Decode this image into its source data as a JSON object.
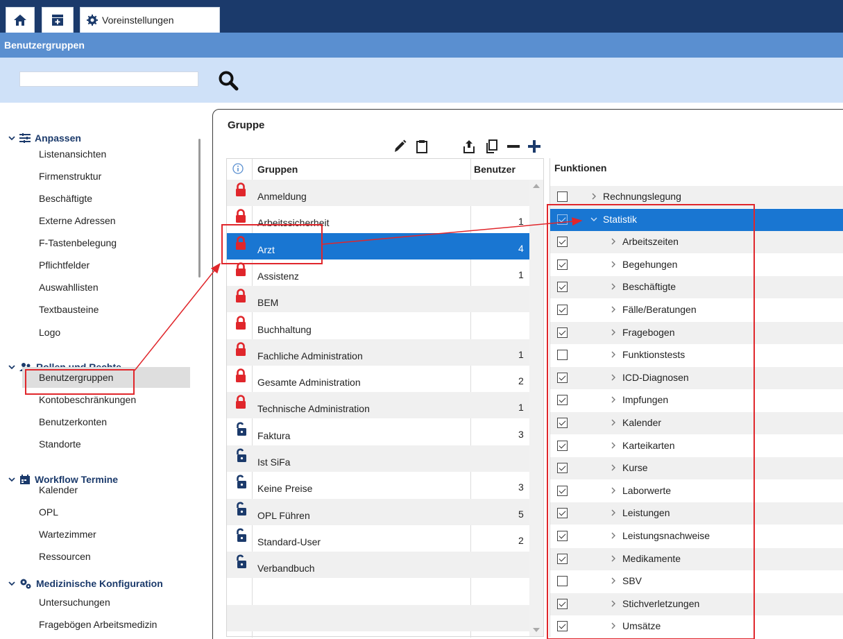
{
  "tabs": {
    "home_icon": "home-icon",
    "add_icon": "add-tab-icon",
    "settings_label": "Voreinstellungen",
    "settings_icon": "gear-icon"
  },
  "header": {
    "title": "Benutzergruppen"
  },
  "search": {
    "value": "",
    "placeholder": "",
    "icon": "search-icon"
  },
  "sidebar": {
    "groups": [
      {
        "label": "Anpassen",
        "icon": "sliders-icon",
        "items": [
          "Listenansichten",
          "Firmenstruktur",
          "Beschäftigte",
          "Externe Adressen",
          "F-Tastenbelegung",
          "Pflichtfelder",
          "Auswahllisten",
          "Textbausteine",
          "Logo"
        ]
      },
      {
        "label": "Rollen und Rechte",
        "icon": "users-icon",
        "items": [
          "Benutzergruppen",
          "Kontobeschränkungen",
          "Benutzerkonten",
          "Standorte"
        ]
      },
      {
        "label": "Workflow Termine",
        "icon": "calendar-icon",
        "items": [
          "Kalender",
          "OPL",
          "Wartezimmer",
          "Ressourcen"
        ]
      },
      {
        "label": "Medizinische Konfiguration",
        "icon": "gears-icon",
        "items": [
          "Untersuchungen",
          "Fragebögen Arbeitsmedizin"
        ]
      }
    ],
    "selected_item": "Benutzergruppen"
  },
  "main": {
    "panel_title": "Gruppe",
    "toolbar": [
      "edit-icon",
      "clipboard-icon",
      "export-icon",
      "copy-icon",
      "remove-icon",
      "add-icon"
    ],
    "groups_table": {
      "headers": {
        "info_icon": "info-icon",
        "name": "Gruppen",
        "count": "Benutzer"
      },
      "rows": [
        {
          "name": "Anmeldung",
          "count": "",
          "locked": true
        },
        {
          "name": "Arbeitssicherheit",
          "count": "1",
          "locked": true
        },
        {
          "name": "Arzt",
          "count": "4",
          "locked": true,
          "selected": true
        },
        {
          "name": "Assistenz",
          "count": "1",
          "locked": true
        },
        {
          "name": "BEM",
          "count": "",
          "locked": true
        },
        {
          "name": "Buchhaltung",
          "count": "",
          "locked": true
        },
        {
          "name": "Fachliche Administration",
          "count": "1",
          "locked": true
        },
        {
          "name": "Gesamte Administration",
          "count": "2",
          "locked": true
        },
        {
          "name": "Technische Administration",
          "count": "1",
          "locked": true
        },
        {
          "name": "Faktura",
          "count": "3",
          "locked": false
        },
        {
          "name": "Ist SiFa",
          "count": "",
          "locked": false
        },
        {
          "name": "Keine Preise",
          "count": "3",
          "locked": false
        },
        {
          "name": "OPL Führen",
          "count": "5",
          "locked": false
        },
        {
          "name": "Standard-User",
          "count": "2",
          "locked": false
        },
        {
          "name": "Verbandbuch",
          "count": "",
          "locked": false
        }
      ]
    },
    "functions": {
      "header": "Funktionen",
      "items": [
        {
          "label": "Rechnungslegung",
          "checked": false,
          "level": 0,
          "expanded": false
        },
        {
          "label": "Statistik",
          "checked": true,
          "level": 0,
          "expanded": true,
          "selected": true
        },
        {
          "label": "Arbeitszeiten",
          "checked": true,
          "level": 1
        },
        {
          "label": "Begehungen",
          "checked": true,
          "level": 1
        },
        {
          "label": "Beschäftigte",
          "checked": true,
          "level": 1
        },
        {
          "label": "Fälle/Beratungen",
          "checked": true,
          "level": 1
        },
        {
          "label": "Fragebogen",
          "checked": true,
          "level": 1
        },
        {
          "label": "Funktionstests",
          "checked": false,
          "level": 1
        },
        {
          "label": "ICD-Diagnosen",
          "checked": true,
          "level": 1
        },
        {
          "label": "Impfungen",
          "checked": true,
          "level": 1
        },
        {
          "label": "Kalender",
          "checked": true,
          "level": 1
        },
        {
          "label": "Karteikarten",
          "checked": true,
          "level": 1
        },
        {
          "label": "Kurse",
          "checked": true,
          "level": 1
        },
        {
          "label": "Laborwerte",
          "checked": true,
          "level": 1
        },
        {
          "label": "Leistungen",
          "checked": true,
          "level": 1
        },
        {
          "label": "Leistungsnachweise",
          "checked": true,
          "level": 1
        },
        {
          "label": "Medikamente",
          "checked": true,
          "level": 1
        },
        {
          "label": "SBV",
          "checked": false,
          "level": 1
        },
        {
          "label": "Stichverletzungen",
          "checked": true,
          "level": 1
        },
        {
          "label": "Umsätze",
          "checked": true,
          "level": 1
        }
      ]
    }
  },
  "colors": {
    "topbar": "#1b3a6b",
    "titlebar": "#5a8fd0",
    "searchbar": "#cfe1f8",
    "selection": "#1976d2",
    "annotation": "#e0262b",
    "lock_red": "#e0262b",
    "lock_navy": "#1b3a6b"
  }
}
